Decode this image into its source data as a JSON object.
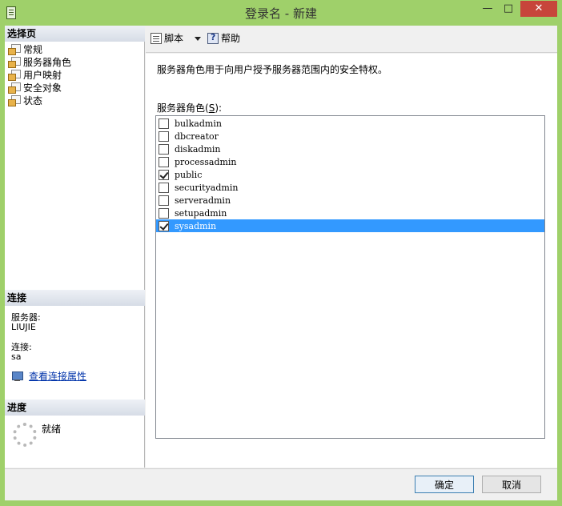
{
  "window": {
    "title": "登录名 - 新建",
    "minimize_glyph": "—",
    "maximize_glyph": "□",
    "close_glyph": "✕"
  },
  "left_pane": {
    "select_page_header": "选择页",
    "pages": [
      {
        "label": "常规"
      },
      {
        "label": "服务器角色"
      },
      {
        "label": "用户映射"
      },
      {
        "label": "安全对象"
      },
      {
        "label": "状态"
      }
    ],
    "connection_header": "连接",
    "server_label": "服务器:",
    "server_value": "LIUJIE",
    "connection_label": "连接:",
    "connection_value": "sa",
    "view_props_link": "查看连接属性",
    "progress_header": "进度",
    "progress_status": "就绪"
  },
  "toolbar": {
    "script_label": "脚本",
    "help_label": "帮助"
  },
  "content": {
    "description": "服务器角色用于向用户授予服务器范围内的安全特权。",
    "roles_label_prefix": "服务器角色(",
    "roles_label_key": "S",
    "roles_label_suffix": "):",
    "roles": [
      {
        "name": "bulkadmin",
        "checked": false
      },
      {
        "name": "dbcreator",
        "checked": false
      },
      {
        "name": "diskadmin",
        "checked": false
      },
      {
        "name": "processadmin",
        "checked": false
      },
      {
        "name": "public",
        "checked": true
      },
      {
        "name": "securityadmin",
        "checked": false
      },
      {
        "name": "serveradmin",
        "checked": false
      },
      {
        "name": "setupadmin",
        "checked": false
      },
      {
        "name": "sysadmin",
        "checked": true,
        "selected": true
      }
    ]
  },
  "footer": {
    "ok_label": "确定",
    "cancel_label": "取消"
  },
  "colors": {
    "frame": "#9fd06a",
    "selection": "#3399ff",
    "close_button": "#c7453b"
  }
}
